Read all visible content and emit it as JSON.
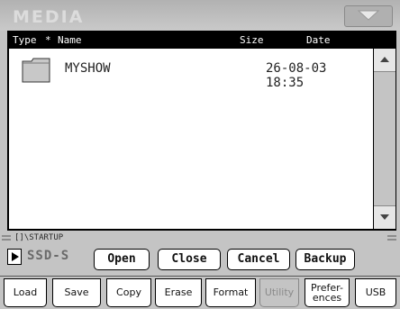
{
  "window": {
    "title": "MEDIA"
  },
  "list": {
    "columns": {
      "type": "Type",
      "sort_marker": "*",
      "name": "Name",
      "size": "Size",
      "date": "Date"
    },
    "items": [
      {
        "icon": "folder-icon",
        "name": "MYSHOW",
        "size": "",
        "date": "26-08-03 18:35"
      }
    ]
  },
  "path": "[]\\STARTUP",
  "device": {
    "label": "SSD-S"
  },
  "actions": {
    "open": "Open",
    "close": "Close",
    "cancel": "Cancel",
    "backup": "Backup"
  },
  "tabs": [
    "Load",
    "Save",
    "Copy",
    "Erase",
    "Format",
    "Utility",
    "Prefer-\nences",
    "USB"
  ],
  "active_tab": "Utility"
}
